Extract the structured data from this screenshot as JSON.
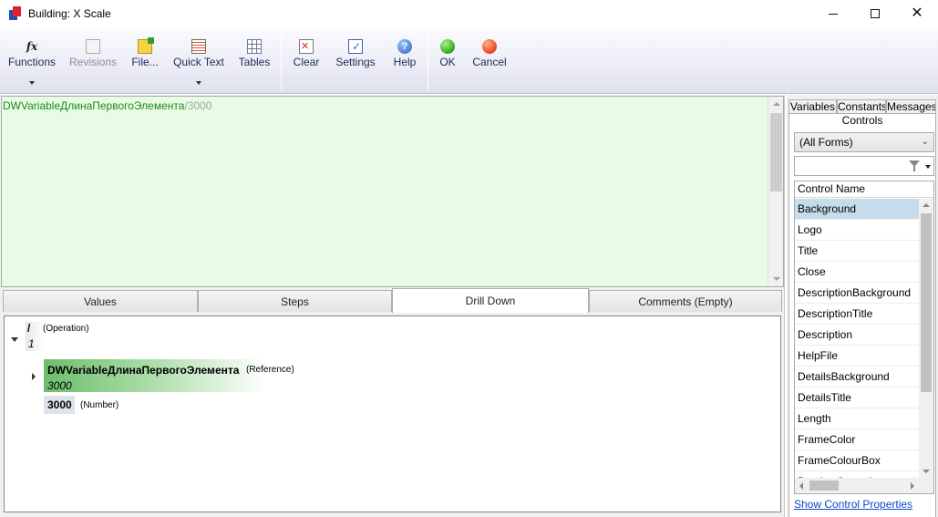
{
  "window": {
    "title": "Building: X Scale",
    "min_glyph": "",
    "max_glyph": "",
    "close_glyph": "✕"
  },
  "toolbar": {
    "functions": "Functions",
    "revisions": "Revisions",
    "file": "File...",
    "quick_text": "Quick Text",
    "tables": "Tables",
    "clear": "Clear",
    "settings": "Settings",
    "help": "Help",
    "ok": "OK",
    "cancel": "Cancel",
    "fx_glyph": "fx",
    "help_glyph": "?"
  },
  "editor": {
    "ref": "DWVariableДлинаПервогоЭлемента",
    "op": "/",
    "num": "3000"
  },
  "tabs": {
    "values": "Values",
    "steps": "Steps",
    "drill_down": "Drill Down",
    "comments": "Comments (Empty)"
  },
  "drill": {
    "op_value": "/",
    "op_type": "(Operation)",
    "op_result": "1",
    "ref_value": "DWVariableДлинаПервогоЭлемента",
    "ref_type": "(Reference)",
    "ref_result": "3000",
    "num_value": "3000",
    "num_type": "(Number)"
  },
  "right_panel": {
    "tabs": {
      "variables": "Variables",
      "constants": "Constants",
      "messages": "Messages",
      "controls": "Controls"
    },
    "forms_select": "(All Forms)",
    "filter_value": "",
    "column_header": "Control Name",
    "controls": [
      "Background",
      "Logo",
      "Title",
      "Close",
      "DescriptionBackground",
      "DescriptionTitle",
      "Description",
      "HelpFile",
      "DetailsBackground",
      "DetailsTitle",
      "Length",
      "FrameColor",
      "FrameColourBox",
      "PreviewControl"
    ],
    "selected_control": "Background",
    "show_properties_link": "Show Control Properties"
  },
  "colors": {
    "editor_bg": "#e8fbe5",
    "reference_text": "#1a8a1a",
    "selection": "#c6dcea",
    "link": "#0a49c8"
  }
}
